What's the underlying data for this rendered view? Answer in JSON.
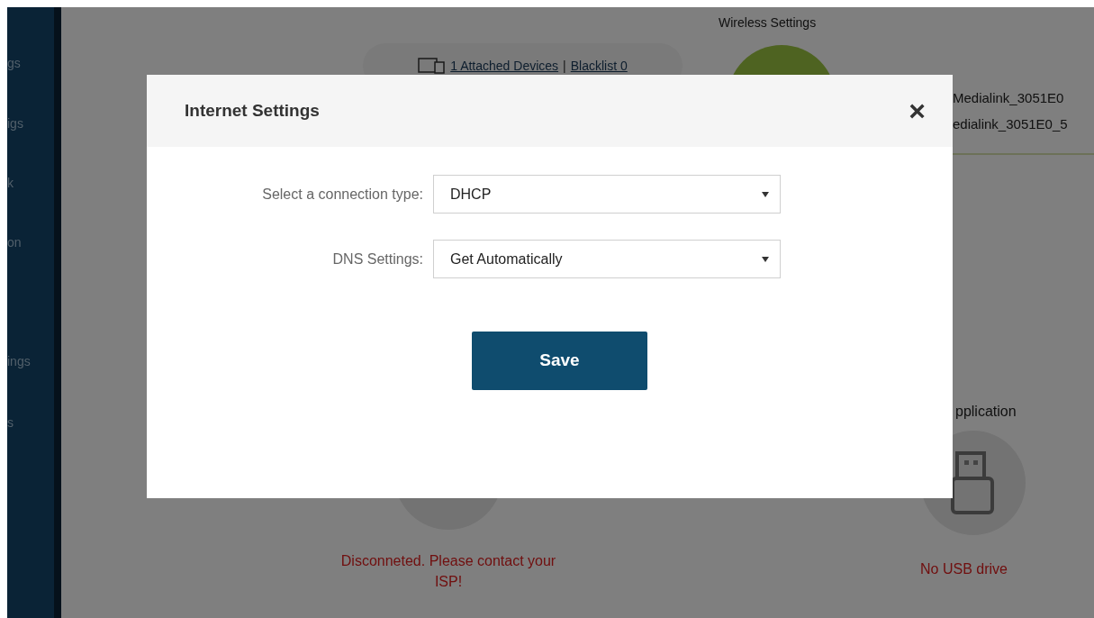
{
  "sidebar": {
    "items": [
      {
        "label": "gs"
      },
      {
        "label": "igs"
      },
      {
        "label": "k"
      },
      {
        "label": "on"
      },
      {
        "label": "ings"
      },
      {
        "label": "s"
      }
    ]
  },
  "dashboard": {
    "devices_link": "1 Attached Devices",
    "separator": "|",
    "blacklist_link": "Blacklist 0",
    "wireless_title": "Wireless Settings",
    "ssid_lines": [
      "Medialink_3051E0",
      "edialink_3051E0_5"
    ],
    "internet_status": "Disconneted. Please contact your ISP!",
    "usb_title": "pplication",
    "usb_status": "No USB drive"
  },
  "modal": {
    "title": "Internet Settings",
    "close": "×",
    "fields": [
      {
        "label": "Select a connection type:",
        "value": "DHCP"
      },
      {
        "label": "DNS Settings:",
        "value": "Get Automatically"
      }
    ],
    "button": "Save"
  }
}
